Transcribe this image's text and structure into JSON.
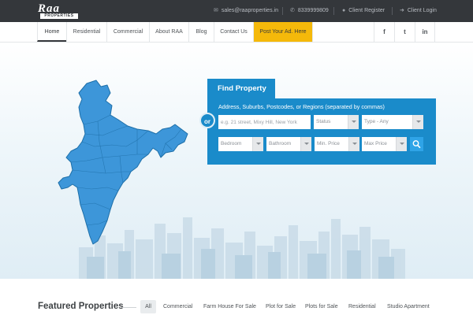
{
  "topbar": {
    "logo_main": "Raa",
    "logo_sub": "PROPERTIES",
    "email": "sales@raaproperties.in",
    "phone": "8339999809",
    "client_register": "Client Register",
    "client_login": "Client Login",
    "icons": [
      "envelope-icon",
      "phone-icon",
      "user-icon",
      "sign-in-icon"
    ]
  },
  "nav": {
    "items": [
      "Home",
      "Residential",
      "Commercial",
      "About RAA",
      "Blog",
      "Contact Us"
    ],
    "active": "Home",
    "cta": "Post Your Ad. Here",
    "social": [
      "f",
      "t",
      "in"
    ]
  },
  "search": {
    "tab": "Find Property",
    "or": "or",
    "label": "Address, Suburbs, Postcodes, or Regions (separated by commas)",
    "address_placeholder": "e.g. 21 street, Mixy Hill, New York",
    "status": "Status",
    "type": "Type - Any",
    "bedroom": "Bedroom",
    "bathroom": "Bathroom",
    "min_price": "Min. Price",
    "max_price": "Max Price"
  },
  "featured": {
    "title": "Featured Properties",
    "filters": [
      "All",
      "Commercial",
      "Farm House For Sale",
      "Plot for Sale",
      "Plots for Sale",
      "Residential",
      "Studio Apartment"
    ],
    "active_filter": "All"
  },
  "colors": {
    "topbar": "#34373b",
    "accent": "#1a8bca",
    "cta": "#f5b90a",
    "map": "#3d96d9"
  }
}
